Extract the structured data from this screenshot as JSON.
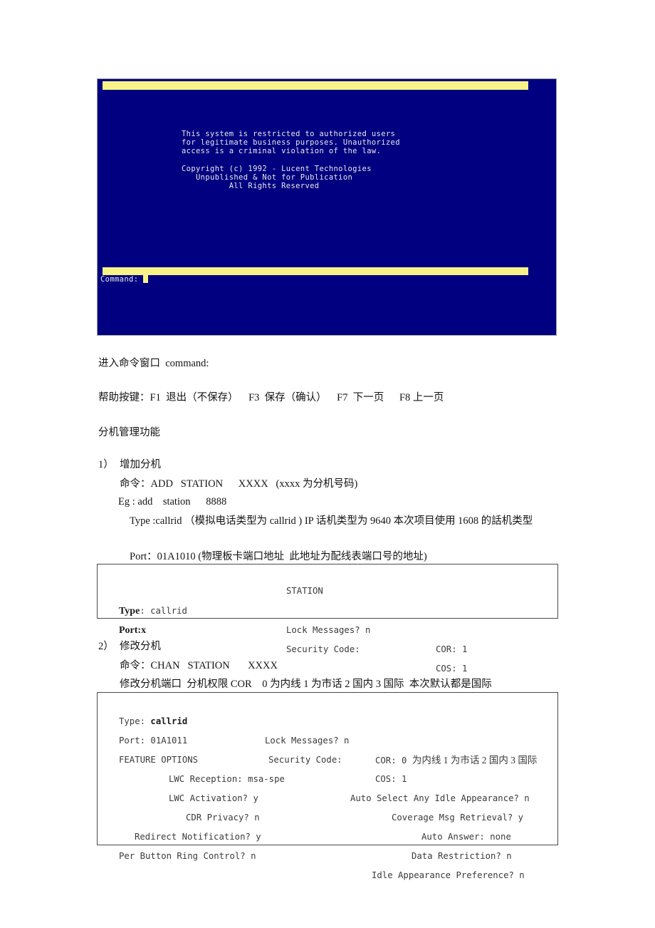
{
  "terminal": {
    "banner_lines": [
      "This system is restricted to authorized users",
      "for legitimate business purposes. Unauthorized",
      "access is a criminal violation of the law.",
      "",
      "Copyright (c) 1992 - Lucent Technologies",
      "   Unpublished & Not for Publication",
      "          All Rights Reserved"
    ],
    "banner_text": "This system is restricted to authorized users\nfor legitimate business purposes. Unauthorized\naccess is a criminal violation of the law.\n\nCopyright (c) 1992 - Lucent Technologies\n   Unpublished & Not for Publication\n          All Rights Reserved",
    "command_label": "Command:",
    "colors": {
      "screen_background": "#000080",
      "bar": "#f7f387",
      "text": "#e8e8e8"
    }
  },
  "document": {
    "intro_line": "进入命令窗口  command:",
    "help_keys_line": "帮助按键：F1  退出（不保存）    F3  保存（确认）    F7  下一页      F8 上一页",
    "section_heading": "分机管理功能",
    "item1": {
      "number": "1）",
      "title": "增加分机",
      "line_command": "命令：ADD   STATION      XXXX   (xxxx 为分机号码)",
      "line_eg": "Eg : add    station      8888",
      "line_type": "Type :callrid    （模拟电话类型为 callrid )    IP  话机类型为 9640  本次项目使用 1608 的話机类型",
      "line_port": "Port：01A1010 (物理板卡端口地址  此地址为配线表端口号的地址)"
    },
    "item2": {
      "number": "2）",
      "title": "修改分机",
      "line_command": "命令：CHAN   STATION       XXXX",
      "line_desc": "修改分机端口  分机权限 COR    0 为内线 1 为市话 2 国内 3 国际  本次默认都是国际"
    }
  },
  "station_form_1": {
    "title": "STATION",
    "rows": [
      {
        "label_bold": "Type",
        "label_rest": ": callrid",
        "mid": "Lock Messages? n",
        "right": "COR: 1"
      },
      {
        "label_bold": "Port:x",
        "label_rest": "",
        "mid": "Security Code:",
        "right": "COS: 1"
      }
    ]
  },
  "station_form_2": {
    "row_type_label": "Type: ",
    "row_type_value": "callrid",
    "row_type_mid": "Lock Messages? n",
    "row_type_right": "COR: 0 ",
    "row_type_right_cn": "为内线 1 为市话 2 国内 3 国际",
    "row_port_label": "Port: 01A1011",
    "row_port_mid": "Security Code:",
    "row_port_right": "COS: 1",
    "feature_options_header": "FEATURE OPTIONS",
    "feature_rows": [
      {
        "left": "LWC Reception: msa-spe",
        "right": "Auto Select Any Idle Appearance? n"
      },
      {
        "left": "LWC Activation? y",
        "right": "Coverage Msg Retrieval? y"
      },
      {
        "left": "CDR Privacy? n",
        "right": "Auto Answer: none"
      },
      {
        "left": "Redirect Notification? y",
        "right": "Data Restriction? n"
      },
      {
        "left": "Per Button Ring Control? n",
        "right": "Idle Appearance Preference? n"
      }
    ]
  }
}
